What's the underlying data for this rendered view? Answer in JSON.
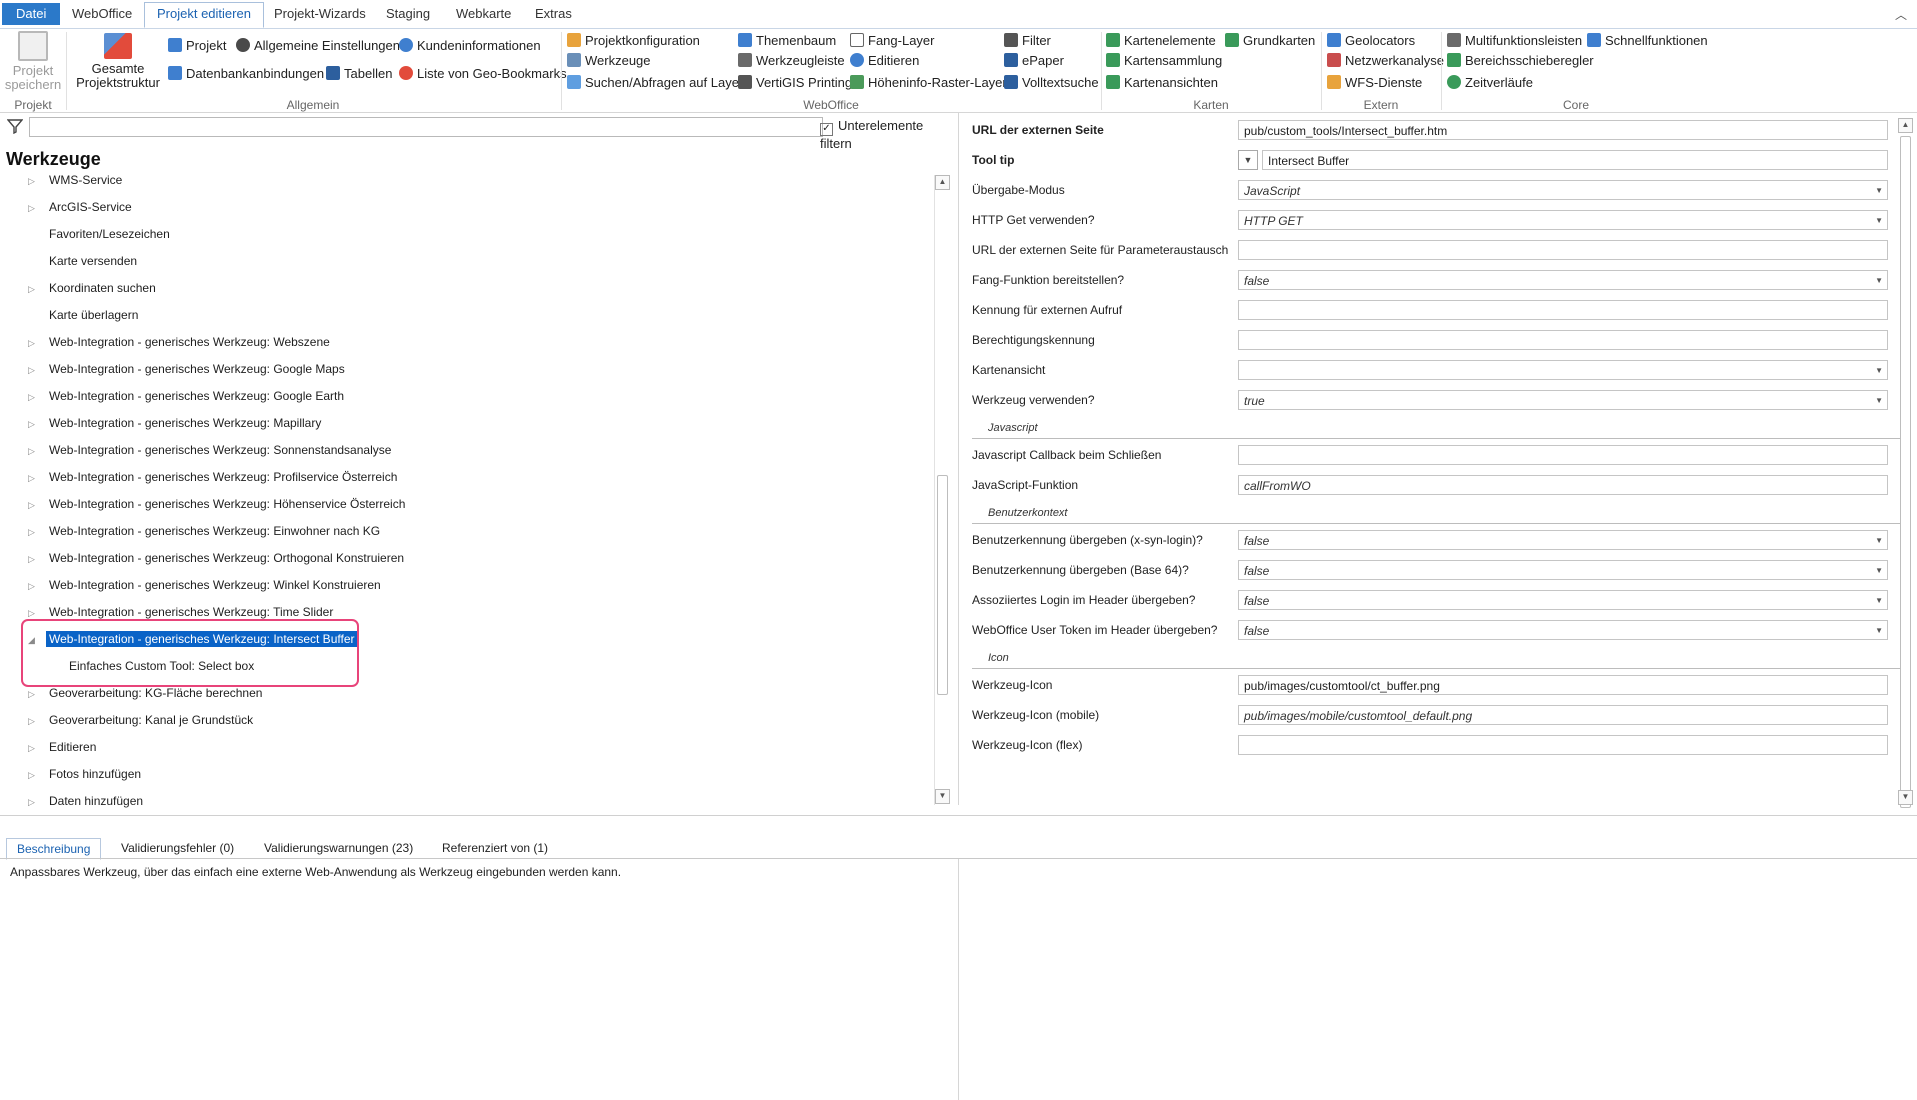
{
  "menu": {
    "tabs": [
      "Datei",
      "WebOffice",
      "Projekt editieren",
      "Projekt-Wizards",
      "Staging",
      "Webkarte",
      "Extras"
    ],
    "active": "Projekt editieren"
  },
  "ribbon": {
    "projekt": {
      "save_label_1": "Projekt",
      "save_label_2": "speichern",
      "group": "Projekt"
    },
    "allgemein": {
      "struct_1": "Gesamte",
      "struct_2": "Projektstruktur",
      "projekt": "Projekt",
      "settings": "Allgemeine Einstellungen",
      "kunden": "Kundeninformationen",
      "db": "Datenbankanbindungen",
      "tabellen": "Tabellen",
      "bookmarks": "Liste von Geo-Bookmarks",
      "group": "Allgemein"
    },
    "weboffice": {
      "items": [
        "Projektkonfiguration",
        "Werkzeuge",
        "Suchen/Abfragen auf Layer",
        "Themenbaum",
        "Werkzeugleiste",
        "VertiGIS Printing",
        "Fang-Layer",
        "Editieren",
        "Höheninfo-Raster-Layer",
        "Filter",
        "ePaper",
        "Volltextsuche"
      ],
      "group": "WebOffice"
    },
    "karten": {
      "items": [
        "Kartenelemente",
        "Kartensammlung",
        "Kartenansichten",
        "Grundkarten"
      ],
      "group": "Karten"
    },
    "extern": {
      "items": [
        "Geolocators",
        "Netzwerkanalyse",
        "WFS-Dienste"
      ],
      "group": "Extern"
    },
    "core": {
      "items": [
        "Multifunktionsleisten",
        "Bereichsschieberegler",
        "Zeitverläufe",
        "Schnellfunktionen"
      ],
      "group": "Core"
    }
  },
  "left": {
    "filter_value": "",
    "subfilter_label": "Unterelemente filtern",
    "title": "Werkzeuge",
    "tree": [
      {
        "label": "WMS-Service",
        "arrow": "▷"
      },
      {
        "label": "ArcGIS-Service",
        "arrow": "▷"
      },
      {
        "label": "Favoriten/Lesezeichen",
        "arrow": ""
      },
      {
        "label": "Karte versenden",
        "arrow": ""
      },
      {
        "label": "Koordinaten suchen",
        "arrow": "▷"
      },
      {
        "label": "Karte überlagern",
        "arrow": ""
      },
      {
        "label": "Web-Integration - generisches Werkzeug: Webszene",
        "arrow": "▷"
      },
      {
        "label": "Web-Integration - generisches Werkzeug: Google Maps",
        "arrow": "▷"
      },
      {
        "label": "Web-Integration - generisches Werkzeug: Google Earth",
        "arrow": "▷"
      },
      {
        "label": "Web-Integration - generisches Werkzeug: Mapillary",
        "arrow": "▷"
      },
      {
        "label": "Web-Integration - generisches Werkzeug: Sonnenstandsanalyse",
        "arrow": "▷"
      },
      {
        "label": "Web-Integration - generisches Werkzeug: Profilservice Österreich",
        "arrow": "▷"
      },
      {
        "label": "Web-Integration - generisches Werkzeug: Höhenservice Österreich",
        "arrow": "▷"
      },
      {
        "label": "Web-Integration - generisches Werkzeug: Einwohner nach KG",
        "arrow": "▷"
      },
      {
        "label": "Web-Integration - generisches Werkzeug: Orthogonal Konstruieren",
        "arrow": "▷"
      },
      {
        "label": "Web-Integration - generisches Werkzeug: Winkel Konstruieren",
        "arrow": "▷"
      },
      {
        "label": "Web-Integration - generisches Werkzeug: Time Slider",
        "arrow": "▷"
      },
      {
        "label": "Web-Integration - generisches Werkzeug: Intersect Buffer",
        "arrow": "◢",
        "selected": true
      },
      {
        "label": "Einfaches Custom Tool: Select box",
        "arrow": "",
        "child": true
      },
      {
        "label": "Geoverarbeitung: KG-Fläche berechnen",
        "arrow": "▷"
      },
      {
        "label": "Geoverarbeitung: Kanal je Grundstück",
        "arrow": "▷"
      },
      {
        "label": "Editieren",
        "arrow": "▷"
      },
      {
        "label": "Fotos hinzufügen",
        "arrow": "▷"
      },
      {
        "label": "Daten hinzufügen",
        "arrow": "▷"
      }
    ]
  },
  "props": {
    "rows": [
      {
        "label": "URL der externen Seite",
        "value": "pub/custom_tools/Intersect_buffer.htm",
        "bold": true
      },
      {
        "label": "Tool tip",
        "value": "Intersect Buffer",
        "bold": true,
        "tip": true
      },
      {
        "label": "Übergabe-Modus",
        "value": "JavaScript",
        "dropdown": true
      },
      {
        "label": "HTTP Get verwenden?",
        "value": "HTTP GET",
        "dropdown": true
      },
      {
        "label": "URL der externen Seite für Parameteraustausch",
        "value": ""
      },
      {
        "label": "Fang-Funktion bereitstellen?",
        "value": "false",
        "dropdown": true
      },
      {
        "label": "Kennung für externen Aufruf",
        "value": ""
      },
      {
        "label": "Berechtigungskennung",
        "value": ""
      },
      {
        "label": "Kartenansicht",
        "value": "",
        "dropdown": true
      },
      {
        "label": "Werkzeug verwenden?",
        "value": "true",
        "dropdown": true
      },
      {
        "section": "Javascript"
      },
      {
        "label": "Javascript Callback beim Schließen",
        "value": ""
      },
      {
        "label": "JavaScript-Funktion",
        "value": "callFromWO"
      },
      {
        "section": "Benutzerkontext"
      },
      {
        "label": "Benutzerkennung übergeben (x-syn-login)?",
        "value": "false",
        "dropdown": true
      },
      {
        "label": "Benutzerkennung übergeben (Base 64)?",
        "value": "false",
        "dropdown": true
      },
      {
        "label": "Assoziiertes Login im Header übergeben?",
        "value": "false",
        "dropdown": true
      },
      {
        "label": "WebOffice User Token im Header übergeben?",
        "value": "false",
        "dropdown": true
      },
      {
        "section": "Icon"
      },
      {
        "label": "Werkzeug-Icon",
        "value": "pub/images/customtool/ct_buffer.png"
      },
      {
        "label": "Werkzeug-Icon (mobile)",
        "value": "pub/images/mobile/customtool_default.png"
      },
      {
        "label": "Werkzeug-Icon (flex)",
        "value": ""
      }
    ]
  },
  "bottom": {
    "tabs": [
      "Beschreibung",
      "Validierungsfehler (0)",
      "Validierungswarnungen (23)",
      "Referenziert von (1)"
    ],
    "description": "Anpassbares Werkzeug, über das einfach eine externe Web-Anwendung als Werkzeug eingebunden werden kann."
  }
}
